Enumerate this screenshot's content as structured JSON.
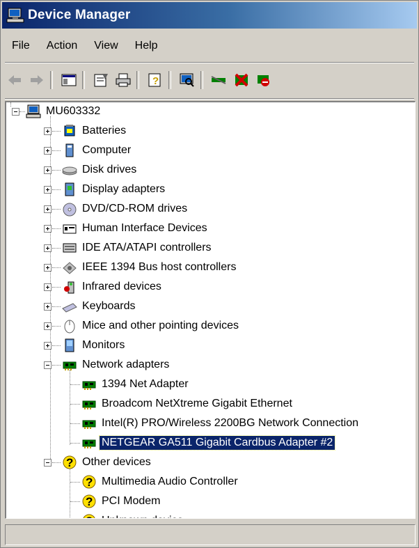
{
  "window": {
    "title": "Device Manager"
  },
  "menu": [
    {
      "label": "File"
    },
    {
      "label": "Action"
    },
    {
      "label": "View"
    },
    {
      "label": "Help"
    }
  ],
  "toolbar": {
    "buttons": [
      "back-icon",
      "forward-icon",
      "show-hide-tree-icon",
      "properties-icon",
      "print-icon",
      "help-icon",
      "scan-hardware-icon",
      "update-driver-icon",
      "uninstall-icon",
      "disable-icon"
    ]
  },
  "tree": {
    "root": "MU603332",
    "categories": [
      {
        "label": "Batteries",
        "icon": "battery-icon",
        "expanded": false
      },
      {
        "label": "Computer",
        "icon": "computer-icon",
        "expanded": false
      },
      {
        "label": "Disk drives",
        "icon": "disk-drive-icon",
        "expanded": false
      },
      {
        "label": "Display adapters",
        "icon": "display-adapter-icon",
        "expanded": false
      },
      {
        "label": "DVD/CD-ROM drives",
        "icon": "cdrom-icon",
        "expanded": false
      },
      {
        "label": "Human Interface Devices",
        "icon": "hid-icon",
        "expanded": false
      },
      {
        "label": "IDE ATA/ATAPI controllers",
        "icon": "ide-icon",
        "expanded": false
      },
      {
        "label": "IEEE 1394 Bus host controllers",
        "icon": "firewire-icon",
        "expanded": false
      },
      {
        "label": "Infrared devices",
        "icon": "infrared-icon",
        "expanded": false
      },
      {
        "label": "Keyboards",
        "icon": "keyboard-icon",
        "expanded": false
      },
      {
        "label": "Mice and other pointing devices",
        "icon": "mouse-icon",
        "expanded": false
      },
      {
        "label": "Monitors",
        "icon": "monitor-icon",
        "expanded": false
      },
      {
        "label": "Network adapters",
        "icon": "network-adapter-icon",
        "expanded": true,
        "children": [
          {
            "label": "1394 Net Adapter",
            "icon": "network-adapter-icon"
          },
          {
            "label": "Broadcom NetXtreme Gigabit Ethernet",
            "icon": "network-adapter-icon"
          },
          {
            "label": "Intel(R) PRO/Wireless 2200BG Network Connection",
            "icon": "network-adapter-icon"
          },
          {
            "label": "NETGEAR GA511 Gigabit Cardbus Adapter #2",
            "icon": "network-adapter-icon",
            "selected": true
          }
        ]
      },
      {
        "label": "Other devices",
        "icon": "unknown-device-icon",
        "expanded": true,
        "children": [
          {
            "label": "Multimedia Audio Controller",
            "icon": "unknown-device-icon"
          },
          {
            "label": "PCI Modem",
            "icon": "unknown-device-icon"
          },
          {
            "label": "Unknown device",
            "icon": "unknown-device-icon"
          }
        ]
      }
    ]
  },
  "statusbar": {
    "text": ""
  },
  "colors": {
    "title_start": "#0a246a",
    "title_end": "#a6caf0",
    "face": "#d4d0c8",
    "selection": "#0a246a"
  }
}
